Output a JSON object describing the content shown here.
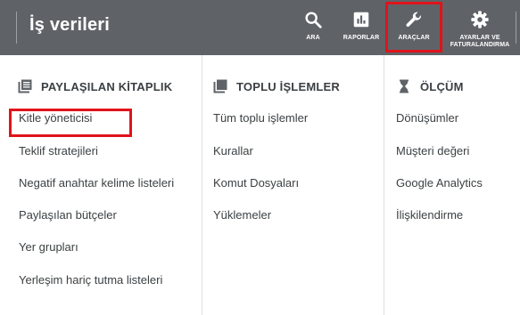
{
  "header": {
    "title": "İş verileri",
    "nav": [
      {
        "key": "ara",
        "label": "ARA",
        "icon": "search-icon"
      },
      {
        "key": "raporlar",
        "label": "RAPORLAR",
        "icon": "reports-icon"
      },
      {
        "key": "araclar",
        "label": "ARAÇLAR",
        "icon": "wrench-icon"
      },
      {
        "key": "ayarlar",
        "label_line1": "AYARLAR VE",
        "label_line2": "FATURALANDIRMA",
        "icon": "gear-icon"
      }
    ]
  },
  "columns": [
    {
      "heading": "PAYLAŞILAN KİTAPLIK",
      "icon": "library-icon",
      "items": [
        "Kitle yöneticisi",
        "Teklif stratejileri",
        "Negatif anahtar kelime listeleri",
        "Paylaşılan bütçeler",
        "Yer grupları",
        "Yerleşim hariç tutma listeleri"
      ]
    },
    {
      "heading": "TOPLU İŞLEMLER",
      "icon": "bulk-actions-icon",
      "items": [
        "Tüm toplu işlemler",
        "Kurallar",
        "Komut Dosyaları",
        "Yüklemeler"
      ]
    },
    {
      "heading": "ÖLÇÜM",
      "icon": "hourglass-icon",
      "items": [
        "Dönüşümler",
        "Müşteri değeri",
        "Google Analytics",
        "İlişkilendirme"
      ]
    }
  ],
  "colors": {
    "header_bg": "#5f6368",
    "highlight": "#e0131b",
    "text": "#3c4043"
  }
}
